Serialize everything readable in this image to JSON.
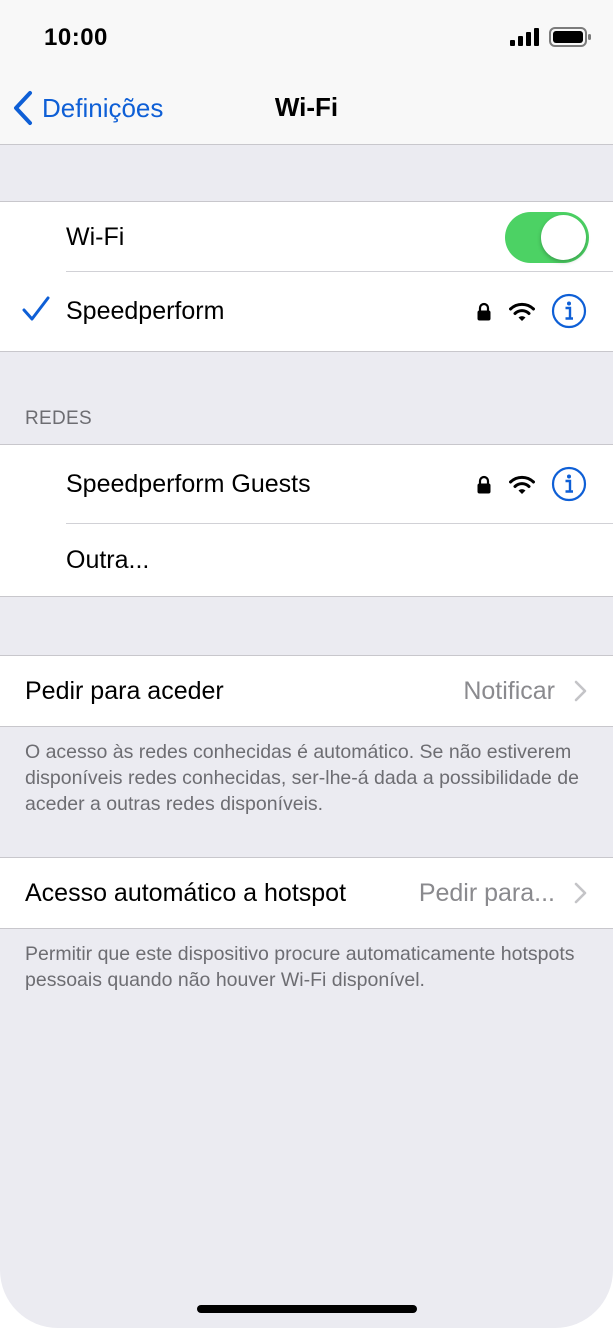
{
  "status_bar": {
    "time": "10:00"
  },
  "nav": {
    "back_label": "Definições",
    "title": "Wi-Fi"
  },
  "wifi_group": {
    "toggle_label": "Wi-Fi",
    "toggle_on": true,
    "connected_network": "Speedperform"
  },
  "networks": {
    "header": "REDES",
    "items": [
      {
        "name": "Speedperform Guests"
      }
    ],
    "other_label": "Outra..."
  },
  "ask_to_join": {
    "label": "Pedir para aceder",
    "value": "Notificar",
    "footer": "O acesso às redes conhecidas é automático. Se não estiverem disponíveis redes conhecidas, ser-lhe-á dada a possibilidade de aceder a outras redes disponíveis."
  },
  "hotspot": {
    "label": "Acesso automático a hotspot",
    "value": "Pedir para...",
    "footer": "Permitir que este dispositivo procure automaticamente hotspots pessoais quando não houver Wi-Fi disponível."
  },
  "colors": {
    "accent": "#0e5fd6",
    "toggle_on": "#4cd264",
    "background": "#ebebf1"
  },
  "icons": {
    "back": "chevron-left-icon",
    "check": "checkmark-icon",
    "lock": "lock-icon",
    "wifi": "wifi-icon",
    "info": "info-icon",
    "disclosure": "chevron-right-icon"
  }
}
